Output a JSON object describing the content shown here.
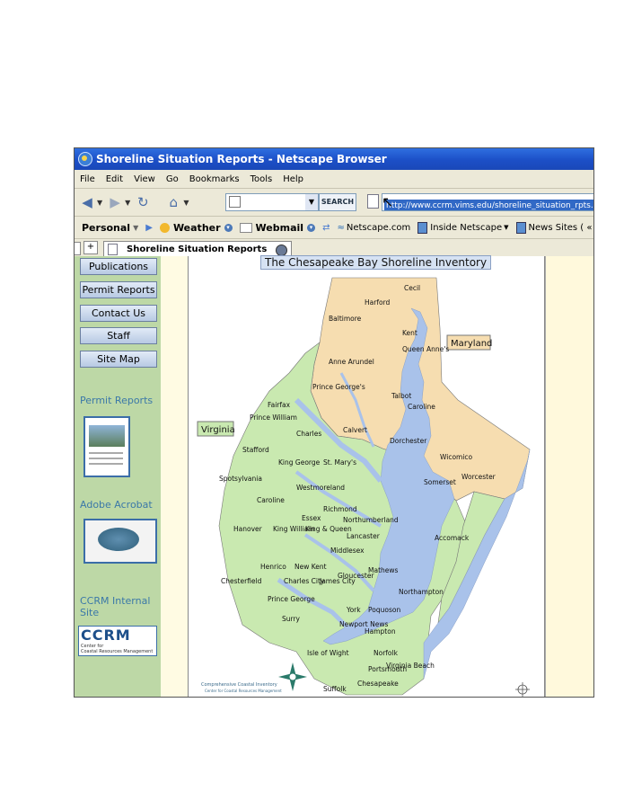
{
  "window": {
    "title": "Shoreline Situation Reports - Netscape Browser"
  },
  "menu": [
    "File",
    "Edit",
    "View",
    "Go",
    "Bookmarks",
    "Tools",
    "Help"
  ],
  "toolbar": {
    "search_button": "SEARCH",
    "url": "http://www.ccrm.vims.edu/shoreline_situation_rpts.html"
  },
  "bookmarks": {
    "personal": "Personal",
    "weather": "Weather",
    "webmail": "Webmail",
    "netscape": "Netscape.com",
    "inside": "Inside Netscape",
    "news": "News Sites ( «"
  },
  "tab": {
    "title": "Shoreline Situation Reports"
  },
  "sidebar": {
    "buttons": [
      "Publications",
      "Permit Reports",
      "Contact Us",
      "Staff",
      "Site Map"
    ],
    "links": {
      "permit_reports": "Permit Reports",
      "adobe": "Adobe Acrobat",
      "ccrm_internal": "CCRM Internal Site"
    },
    "ccrm_logo": {
      "big": "CCRM",
      "small1": "Center for",
      "small2": "Coastal Resources Management"
    }
  },
  "map": {
    "title": "The Chesapeake Bay Shoreline Inventory",
    "states": {
      "maryland": "Maryland",
      "virginia": "Virginia"
    },
    "counties": [
      "Cecil",
      "Harford",
      "Baltimore",
      "Kent",
      "Queen Anne's",
      "Anne Arundel",
      "Prince George's",
      "Talbot",
      "Caroline",
      "Fairfax",
      "Prince William",
      "Calvert",
      "Charles",
      "Dorchester",
      "Stafford",
      "King George",
      "St. Mary's",
      "Wicomico",
      "Worcester",
      "Somerset",
      "Spotsylvania",
      "Westmoreland",
      "Caroline",
      "Richmond",
      "Essex",
      "Northumberland",
      "Hanover",
      "King William",
      "King & Queen",
      "Lancaster",
      "Middlesex",
      "Accomack",
      "Henrico",
      "New Kent",
      "Chesterfield",
      "Charles City",
      "James City",
      "Gloucester",
      "Mathews",
      "Northampton",
      "Prince George",
      "Surry",
      "York",
      "Poquoson",
      "Newport News",
      "Hampton",
      "Isle of Wight",
      "Norfolk",
      "Portsmouth",
      "Virginia Beach",
      "Suffolk",
      "Chesapeake"
    ],
    "footer": "Comprehensive Coastal Inventory",
    "footer2": "Center for Coastal Resources Management",
    "colors": {
      "maryland": "#f6ddb0",
      "virginia": "#c9e9b0",
      "water": "#a9c2ea"
    }
  }
}
